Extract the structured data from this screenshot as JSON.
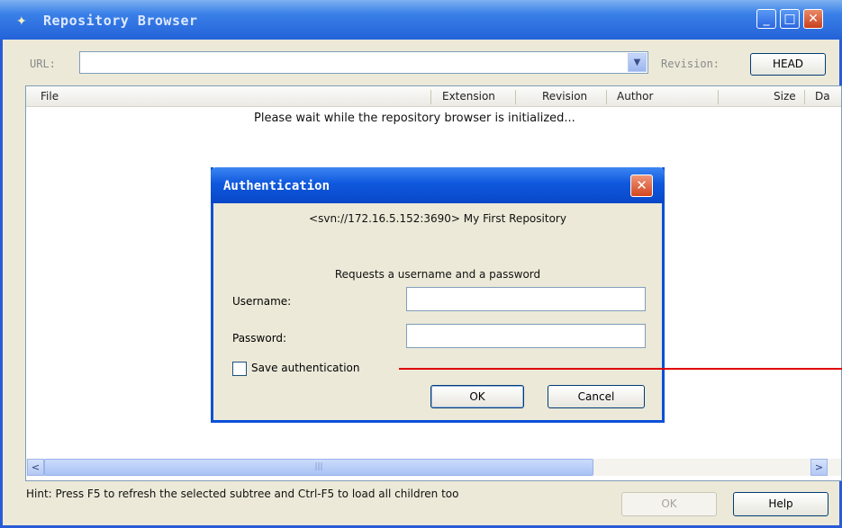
{
  "window": {
    "title": "Repository Browser",
    "minimize": "_",
    "maximize": "□",
    "close": "✕"
  },
  "url_bar": {
    "label": "URL:",
    "value": "",
    "dropdown_glyph": "▼",
    "revision_label": "Revision:",
    "revision_button": "HEAD"
  },
  "list": {
    "columns": [
      "File",
      "Extension",
      "Revision",
      "Author",
      "Size",
      "Da"
    ],
    "message": "Please wait while the repository browser is initialized..."
  },
  "scrollbar": {
    "left": "<",
    "right": ">",
    "grip": "|||"
  },
  "footer": {
    "hint": "Hint: Press F5 to refresh the selected subtree and Ctrl-F5 to load all children too",
    "ok": "OK",
    "help": "Help"
  },
  "auth_dialog": {
    "title": "Authentication",
    "close": "✕",
    "realm": "<svn://172.16.5.152:3690> My First Repository",
    "request": "Requests a username and a password",
    "username_label": "Username:",
    "username_value": "",
    "password_label": "Password:",
    "password_value": "",
    "save_label": "Save authentication",
    "save_checked": false,
    "ok": "OK",
    "cancel": "Cancel"
  },
  "colors": {
    "titlebar": "#2362d8",
    "dialog_titlebar": "#0847c7",
    "annotation_line": "#e00000",
    "face": "#ece9d8"
  }
}
